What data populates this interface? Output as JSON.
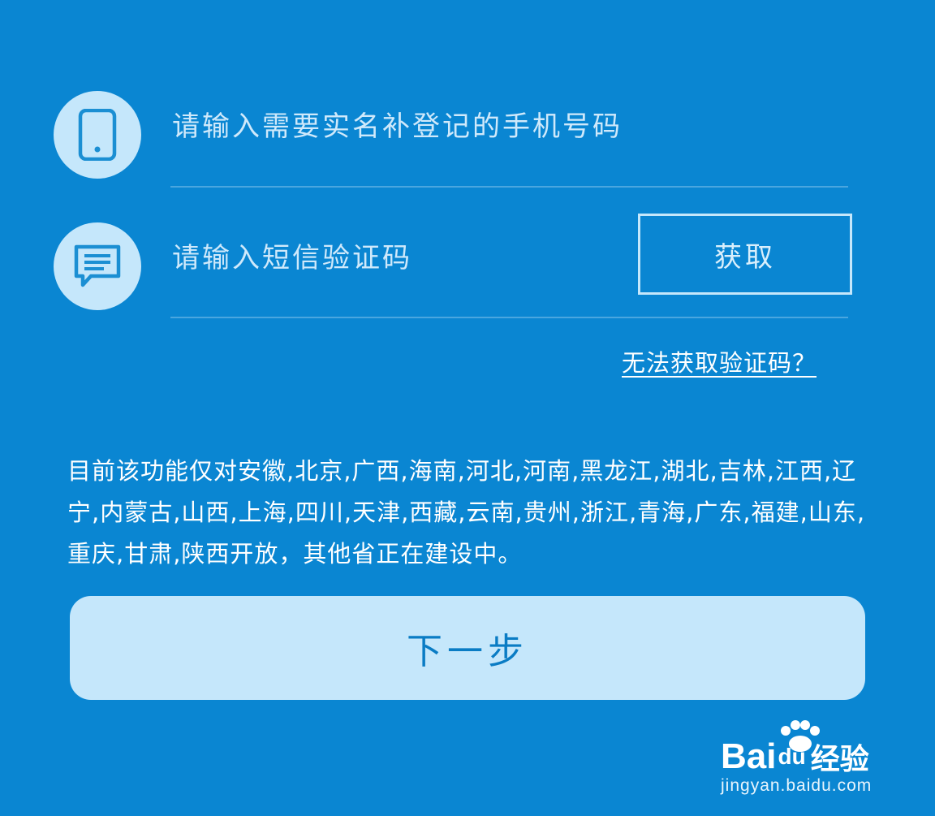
{
  "phone": {
    "icon": "smartphone-icon",
    "placeholder": "请输入需要实名补登记的手机号码"
  },
  "sms": {
    "icon": "message-icon",
    "placeholder": "请输入短信验证码",
    "get_code_label": "获取"
  },
  "help_link": "无法获取验证码？",
  "notice": "目前该功能仅对安徽,北京,广西,海南,河北,河南,黑龙江,湖北,吉林,江西,辽宁,内蒙古,山西,上海,四川,天津,西藏,云南,贵州,浙江,青海,广东,福建,山东,重庆,甘肃,陕西开放，其他省正在建设中。",
  "next_button": "下一步",
  "watermark": {
    "logo_prefix": "Bai",
    "logo_du": "du",
    "logo_suffix": "经验",
    "url": "jingyan.baidu.com"
  },
  "colors": {
    "background": "#0a86d2",
    "accent_light": "#c5e7fb",
    "next_text": "#0a7cc4"
  }
}
